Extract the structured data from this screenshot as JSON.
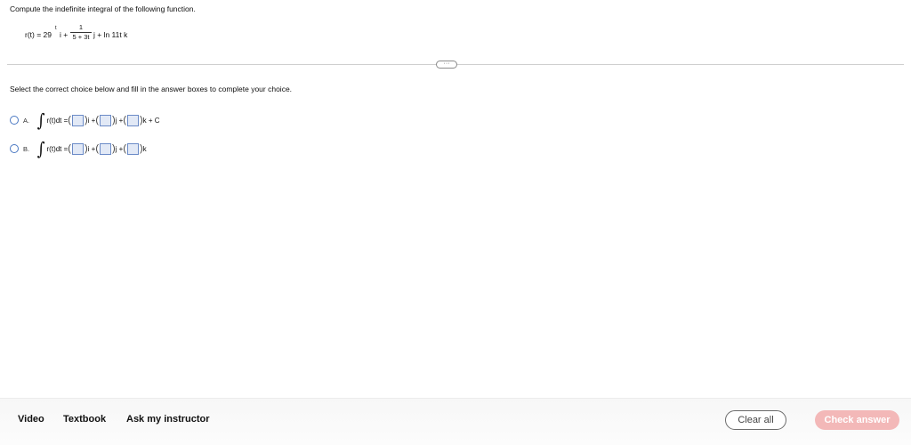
{
  "prompt": "Compute the indefinite integral of the following function.",
  "function": {
    "lhs": "r(t) = 29",
    "exponent": "t",
    "i_term": "i +",
    "fraction_numerator": "1",
    "fraction_denominator": "5 + 3t",
    "rest": "j + ln 11t k"
  },
  "more_button": "···",
  "instruction": "Select the correct choice below and fill in the answer boxes to complete your choice.",
  "choices": [
    {
      "label": "A.",
      "expression": "r(t)dt =",
      "i": "i +",
      "j": "j +",
      "k": "k + C"
    },
    {
      "label": "B.",
      "expression": "r(t)dt =",
      "i": "i +",
      "j": "j +",
      "k": "k"
    }
  ],
  "integral_symbol": "∫",
  "paren_open": "(",
  "paren_close": ")",
  "footer": {
    "video": "Video",
    "textbook": "Textbook",
    "ask": "Ask my instructor",
    "clear_all": "Clear all",
    "check_answer": "Check answer"
  },
  "colors": {
    "check_answer_bg": "#f3b8b8",
    "radio": "#4a78c2",
    "answer_box": "#e2e9f6"
  }
}
